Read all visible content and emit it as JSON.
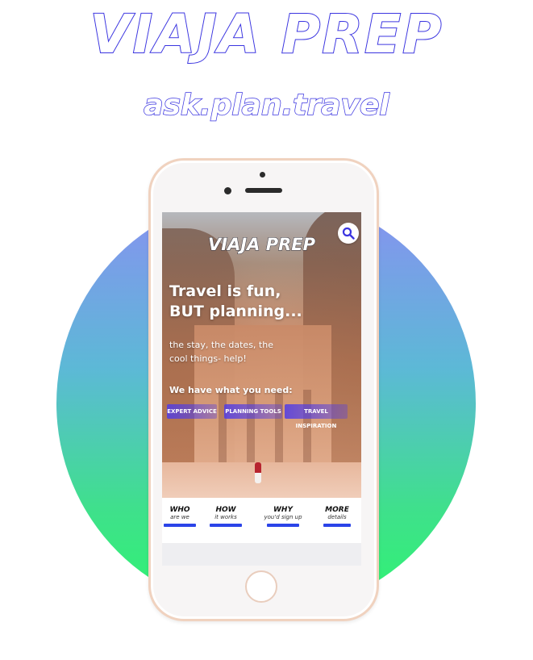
{
  "brand": {
    "title": "VIAJA PREP",
    "tagline": "ask.plan.travel"
  },
  "colors": {
    "accent": "#3b35e0",
    "nav_underline": "#2b44e8",
    "circle_top": "#8a8ff2",
    "circle_bottom": "#2ef56f"
  },
  "phone": {
    "screen": {
      "logo": "VIAJA PREP",
      "search_icon": "search-icon",
      "headline_line1": "Travel is fun,",
      "headline_line2": "BUT planning...",
      "sub_line1": "the stay, the dates, the",
      "sub_line2": "cool things- help!",
      "need_text": "We have what you need:",
      "cta_buttons": [
        {
          "label": "EXPERT ADVICE"
        },
        {
          "label": "PLANNING TOOLS"
        },
        {
          "label": "TRAVEL INSPIRATION"
        }
      ],
      "nav": [
        {
          "main": "WHO",
          "sub": "are we"
        },
        {
          "main": "HOW",
          "sub": "it works"
        },
        {
          "main": "WHY",
          "sub": "you'd sign up"
        },
        {
          "main": "MORE",
          "sub": "details"
        }
      ]
    }
  }
}
